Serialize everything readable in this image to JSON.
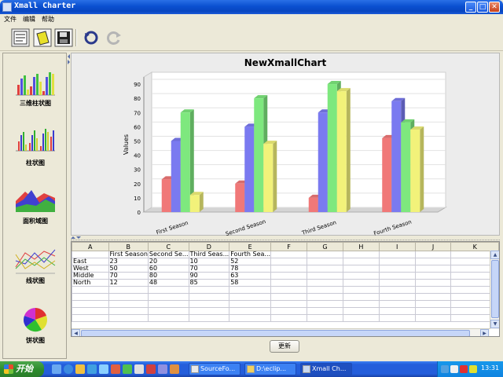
{
  "window": {
    "title": "Xmall Charter"
  },
  "menu": [
    "文件",
    "编辑",
    "帮助"
  ],
  "toolbar": {
    "icons": [
      "new-document-icon",
      "open-folder-icon",
      "save-icon",
      "undo-icon",
      "redo-icon"
    ]
  },
  "chart_types": [
    {
      "label": "三维柱状图",
      "icon": "bar-3d-chart-icon"
    },
    {
      "label": "柱状图",
      "icon": "bar-chart-icon"
    },
    {
      "label": "面积域图",
      "icon": "area-chart-icon"
    },
    {
      "label": "线状图",
      "icon": "line-chart-icon"
    },
    {
      "label": "饼状图",
      "icon": "pie-chart-icon"
    }
  ],
  "chart_data": {
    "type": "bar",
    "title": "NewXmallChart",
    "xlabel": "",
    "ylabel": "Values",
    "categories": [
      "First Season",
      "Second Season",
      "Third Season",
      "Fourth Season"
    ],
    "series": [
      {
        "name": "East",
        "values": [
          23,
          20,
          10,
          52
        ]
      },
      {
        "name": "West",
        "values": [
          50,
          60,
          70,
          78
        ]
      },
      {
        "name": "Middle",
        "values": [
          70,
          80,
          90,
          63
        ]
      },
      {
        "name": "North",
        "values": [
          12,
          48,
          85,
          58
        ]
      }
    ],
    "ylim": [
      0,
      95
    ],
    "yticks": [
      0,
      10,
      20,
      30,
      40,
      50,
      60,
      70,
      80,
      90
    ],
    "grid": true,
    "colors": [
      "#f07878",
      "#7a7af0",
      "#7ee87e",
      "#f2f27a"
    ]
  },
  "table": {
    "columns": [
      "A",
      "B",
      "C",
      "D",
      "E",
      "F",
      "G",
      "H",
      "I",
      "J",
      "K"
    ],
    "rows": [
      [
        "",
        "First Season",
        "Second Se...",
        "Third Seas...",
        "Fourth Sea...",
        "",
        "",
        "",
        "",
        "",
        ""
      ],
      [
        "East",
        "23",
        "20",
        "10",
        "52",
        "",
        "",
        "",
        "",
        "",
        ""
      ],
      [
        "West",
        "50",
        "60",
        "70",
        "78",
        "",
        "",
        "",
        "",
        "",
        ""
      ],
      [
        "Middle",
        "70",
        "80",
        "90",
        "63",
        "",
        "",
        "",
        "",
        "",
        ""
      ],
      [
        "North",
        "12",
        "48",
        "85",
        "58",
        "",
        "",
        "",
        "",
        "",
        ""
      ],
      [
        "",
        "",
        "",
        "",
        "",
        "",
        "",
        "",
        "",
        "",
        ""
      ],
      [
        "",
        "",
        "",
        "",
        "",
        "",
        "",
        "",
        "",
        "",
        ""
      ],
      [
        "",
        "",
        "",
        "",
        "",
        "",
        "",
        "",
        "",
        "",
        ""
      ],
      [
        "",
        "",
        "",
        "",
        "",
        "",
        "",
        "",
        "",
        "",
        ""
      ],
      [
        "",
        "",
        "",
        "",
        "",
        "",
        "",
        "",
        "",
        "",
        ""
      ]
    ]
  },
  "refresh_label": "更新",
  "taskbar": {
    "start_label": "开始",
    "tasks": [
      {
        "label": "SourceFo..."
      },
      {
        "label": "D:\\eclip..."
      },
      {
        "label": "Xmall Ch..."
      }
    ],
    "clock": "13:31"
  }
}
